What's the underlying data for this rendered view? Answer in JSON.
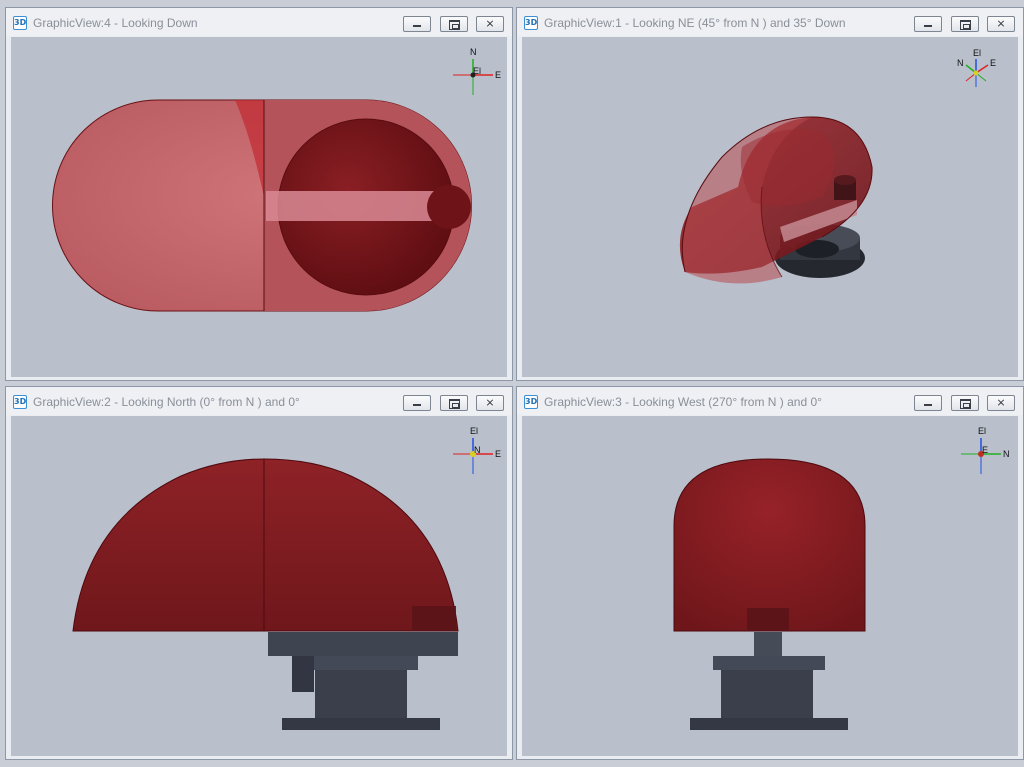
{
  "views": [
    {
      "id": "gv4",
      "app_icon": "3D",
      "title": "GraphicView:4 - Looking Down",
      "triad": {
        "labels": [
          "N",
          "E",
          "El"
        ]
      }
    },
    {
      "id": "gv1",
      "app_icon": "3D",
      "title": "GraphicView:1 - Looking NE (45° from N ) and 35° Down",
      "triad": {
        "labels": [
          "El",
          "N",
          "E"
        ]
      }
    },
    {
      "id": "gv2",
      "app_icon": "3D",
      "title": "GraphicView:2 - Looking North (0° from N ) and 0°",
      "triad": {
        "labels": [
          "El",
          "E",
          "N"
        ]
      }
    },
    {
      "id": "gv3",
      "app_icon": "3D",
      "title": "GraphicView:3 - Looking West (270° from N ) and 0°",
      "triad": {
        "labels": [
          "El",
          "N",
          "E"
        ]
      }
    }
  ],
  "window_buttons": {
    "minimize": "minimize-icon",
    "maximize": "maximize-icon",
    "close": "close-icon",
    "close_glyph": "⨯"
  },
  "colors": {
    "viewport_bg": "#b9bfcb",
    "radome_red": "#8b1e22",
    "radome_red_light": "#c96a70",
    "pedestal": "#3d4250",
    "axis_x": "#e02020",
    "axis_y": "#20b020",
    "axis_z": "#2050e0"
  }
}
